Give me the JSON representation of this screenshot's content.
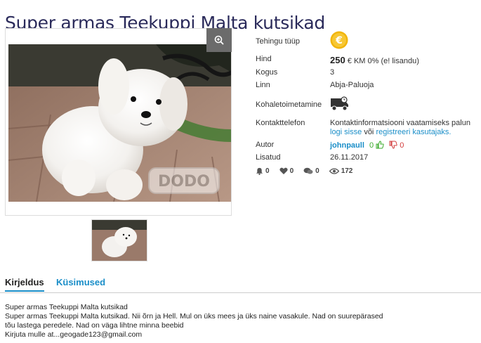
{
  "listing": {
    "title": "Super armas Teekuppi Malta kutsikad"
  },
  "info": {
    "deal_type_label": "Tehingu tüüp",
    "price_label": "Hind",
    "price_value": "250",
    "price_currency": "€ KM 0% (e! lisandu)",
    "quantity_label": "Kogus",
    "quantity_value": "3",
    "city_label": "Linn",
    "city_value": "Abja-Paluoja",
    "delivery_label": "Kohaletoimetamine",
    "phone_label": "Kontakttelefon",
    "phone_text_1": "Kontaktinformatsiooni vaatamiseks palun",
    "login_link": "logi sisse",
    "or_text": "või",
    "register_link": "registreeri kasutajaks.",
    "author_label": "Autor",
    "author_name": "johnpaull",
    "author_pos": "0",
    "author_neg": "0",
    "added_label": "Lisatud",
    "added_value": "26.11.2017"
  },
  "stats": {
    "bells": "0",
    "hearts": "0",
    "comments": "0",
    "views": "172"
  },
  "tabs": {
    "description": "Kirjeldus",
    "questions": "Küsimused"
  },
  "description": {
    "line1": "Super armas Teekuppi Malta kutsikad",
    "line2": "Super armas Teekuppi Malta kutsikad. Nii õrn ja Hell. Mul on üks mees ja üks naine vasakule. Nad on suurepärased",
    "line3": "tõu lastega peredele. Nad on väga lihtne minna beebid",
    "line4": "Kirjuta mulle at...geogade123@gmail.com"
  },
  "watermark": "DODO",
  "colors": {
    "accent": "#1a8ec8",
    "title": "#2a2a5a",
    "coin": "#f2b50a"
  }
}
